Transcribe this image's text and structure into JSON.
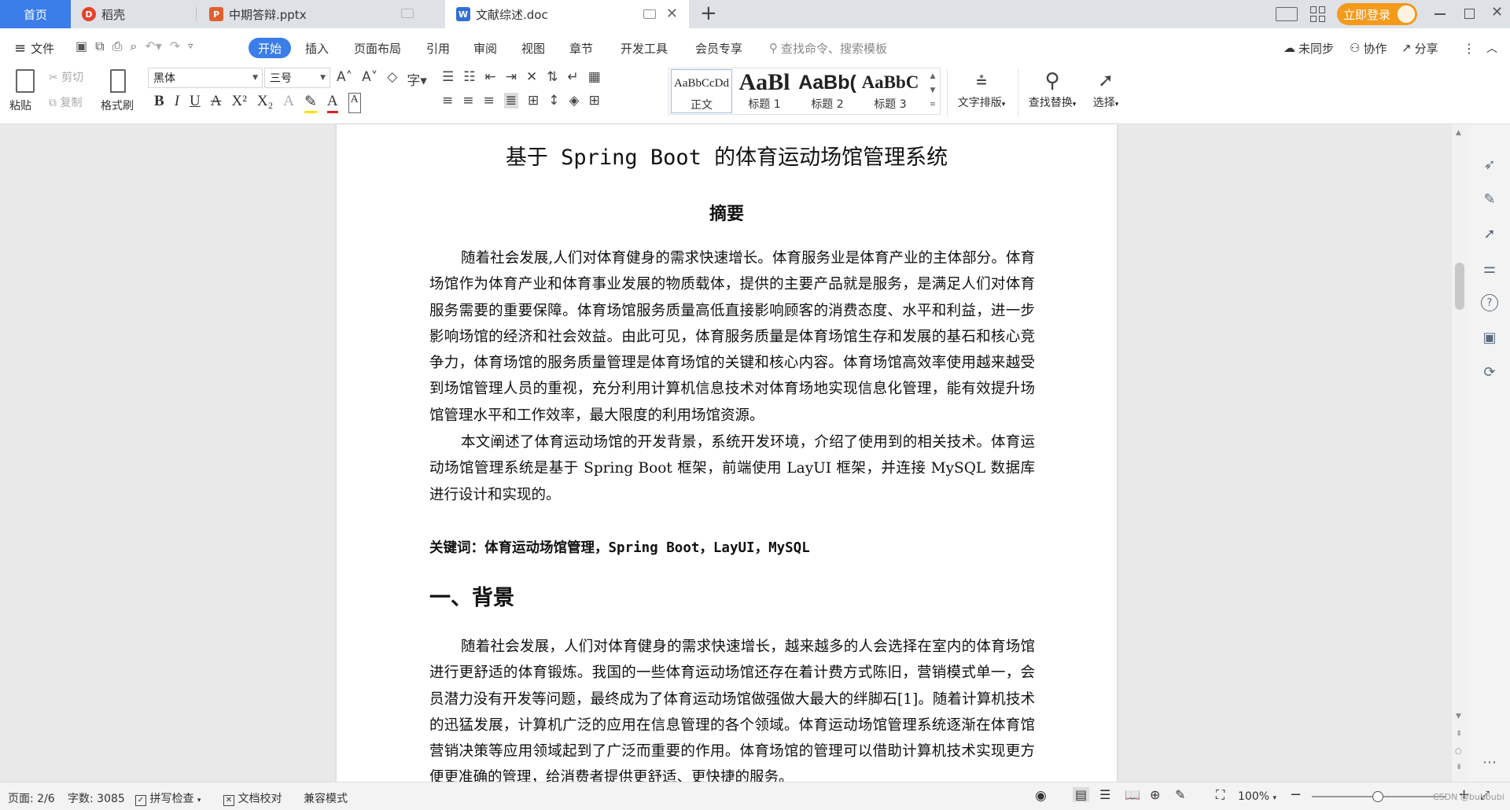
{
  "tabs": {
    "home": "首页",
    "daoke": "稻壳",
    "pptx": "中期答辩.pptx",
    "doc": "文献综述.doc",
    "new_tab": "+"
  },
  "titlebar": {
    "login_button": "立即登录"
  },
  "menu": {
    "file": "文件",
    "items": [
      "开始",
      "插入",
      "页面布局",
      "引用",
      "审阅",
      "视图",
      "章节",
      "开发工具",
      "会员专享"
    ],
    "search_placeholder": "查找命令、搜索模板",
    "sync": "未同步",
    "collab": "协作",
    "share": "分享"
  },
  "ribbon": {
    "paste": "粘贴",
    "cut": "剪切",
    "copy": "复制",
    "format_painter": "格式刷",
    "font_name": "黑体",
    "font_size": "三号",
    "styles": [
      {
        "preview": "AaBbCcDd",
        "name": "正文"
      },
      {
        "preview": "AaBl",
        "name": "标题 1"
      },
      {
        "preview": "AaBb(",
        "name": "标题 2"
      },
      {
        "preview": "AaBbC",
        "name": "标题 3"
      }
    ],
    "text_layout": "文字排版",
    "find_replace": "查找替换",
    "select": "选择"
  },
  "document": {
    "title": "基于 Spring Boot 的体育运动场馆管理系统",
    "abstract_heading": "摘要",
    "abstract_p1": "随着社会发展,人们对体育健身的需求快速增长。体育服务业是体育产业的主体部分。体育场馆作为体育产业和体育事业发展的物质载体，提供的主要产品就是服务，是满足人们对体育服务需要的重要保障。体育场馆服务质量高低直接影响顾客的消费态度、水平和利益，进一步影响场馆的经济和社会效益。由此可见，体育服务质量是体育场馆生存和发展的基石和核心竞争力，体育场馆的服务质量管理是体育场馆的关键和核心内容。体育场馆高效率使用越来越受到场馆管理人员的重视，充分利用计算机信息技术对体育场地实现信息化管理，能有效提升场馆管理水平和工作效率，最大限度的利用场馆资源。",
    "abstract_p2": "本文阐述了体育运动场馆的开发背景，系统开发环境，介绍了使用到的相关技术。体育运动场馆管理系统是基于 Spring Boot 框架，前端使用 LayUI 框架，并连接 MySQL 数据库进行设计和实现的。",
    "keywords": "关键词：体育运动场馆管理，Spring Boot，LayUI，MySQL",
    "section1": "一、背景",
    "section1_p1": "随着社会发展，人们对体育健身的需求快速增长，越来越多的人会选择在室内的体育场馆进行更舒适的体育锻炼。我国的一些体育运动场馆还存在着计费方式陈旧，营销模式单一，会员潜力没有开发等问题，最终成为了体育运动场馆做强做大最大的绊脚石[1]。随着计算机技术的迅猛发展，计算机广泛的应用在信息管理的各个领域。体育运动场馆管理系统逐渐在体育馆营销决策等应用领域起到了广泛而重要的作用。体育场馆的管理可以借助计算机技术实现更方便更准确的管理，给消费者提供更舒适、更快捷的服务。"
  },
  "status": {
    "page": "页面: 2/6",
    "words": "字数: 3085",
    "spell": "拼写检查",
    "proof": "文档校对",
    "compat": "兼容模式",
    "zoom": "100%",
    "watermark": "CSDN @bubbubi"
  },
  "colors": {
    "accent": "#3b7de9",
    "login_orange": "#f39a1a",
    "wps_red": "#e5412a"
  }
}
